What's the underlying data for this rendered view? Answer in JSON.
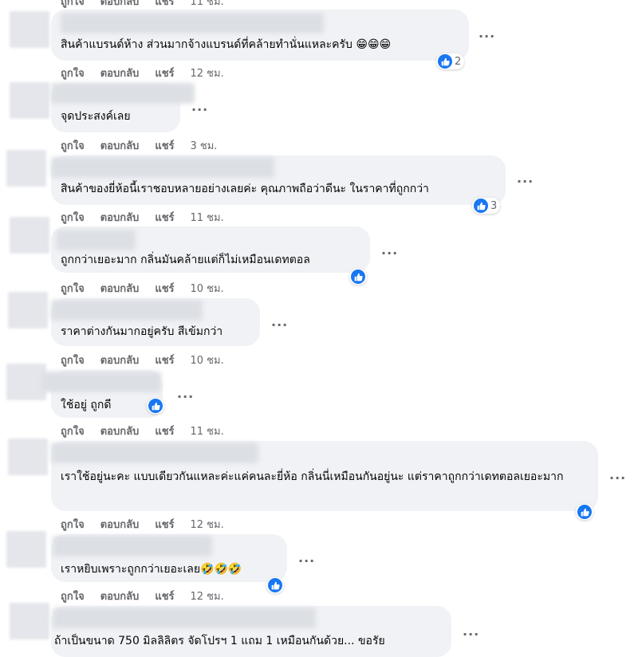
{
  "actions": {
    "like": "ถูกใจ",
    "reply": "ตอบกลับ",
    "share": "แชร์"
  },
  "top_partial": {
    "like": "ถูกใจ",
    "reply": "ตอบกลับ",
    "share": "แชร์",
    "time": "11 ชม."
  },
  "comments": [
    {
      "text": "สินค้าแบรนด์ห้าง ส่วนมากจ้างแบรนด์ที่คล้ายทำนั่นแหละครับ",
      "emoji": "😁😁😁",
      "reaction_count": "2",
      "time": "12 ชม."
    },
    {
      "text": "จุดประสงค์เลย",
      "emoji": "",
      "reaction_count": "",
      "time": "3 ชม."
    },
    {
      "text": "สินค้าของยี่ห้อนี้เราชอบหลายอย่างเลยค่ะ คุณภาพถือว่าดีนะ ในราคาที่ถูกกว่า",
      "emoji": "",
      "reaction_count": "3",
      "time": "11 ชม."
    },
    {
      "text": "ถูกกว่าเยอะมาก กลิ่นมันคล้ายแต่ก็ไม่เหมือนเดทตอล",
      "emoji": "",
      "reaction_count": "",
      "time": "10 ชม."
    },
    {
      "text": "ราคาต่างกันมากอยู่ครับ สีเข้มกว่า",
      "emoji": "",
      "reaction_count": "",
      "time": "10 ชม."
    },
    {
      "text": "ใช้อยู่ ถูกดี",
      "emoji": "",
      "reaction_count": "",
      "time": "11 ชม."
    },
    {
      "text": "เราใช้อยู่นะคะ แบบเดียวกันแหละค่ะแค่คนละยี่ห้อ กลิ่นนี่เหมือนกันอยู่นะ แต่ราคาถูกกว่าเดทตอลเยอะมาก",
      "emoji": "",
      "reaction_count": "",
      "time": "12 ชม."
    },
    {
      "text": "เราหยิบเพราะถูกกว่าเยอะเลย",
      "emoji": "🤣🤣🤣",
      "reaction_count": "",
      "time": "12 ชม."
    },
    {
      "text": "ถ้าเป็นขนาด 750 มิลลิลิตร จัดโปรฯ 1 แถม 1 เหมือนกันด้วย... ขอรัย",
      "emoji": "",
      "reaction_count": "",
      "time": ""
    }
  ],
  "colors": {
    "bubble": "#f0f2f5",
    "like_blue": "#1877f2",
    "meta_gray": "#65676b"
  },
  "icons": {
    "reaction": "like-icon",
    "more": "more-options-icon"
  }
}
